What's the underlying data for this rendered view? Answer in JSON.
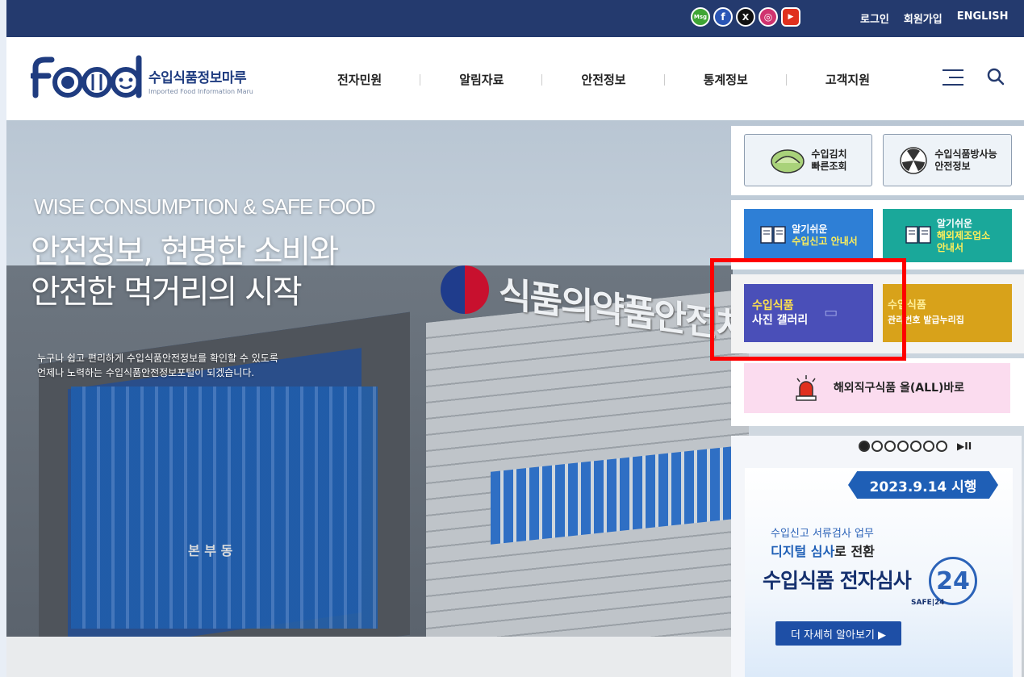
{
  "top_bar": {
    "social": [
      {
        "name": "kakaotalk-icon",
        "glyph": "Msg"
      },
      {
        "name": "facebook-icon",
        "glyph": "f"
      },
      {
        "name": "x-twitter-icon",
        "glyph": "X"
      },
      {
        "name": "instagram-icon",
        "glyph": "◎"
      },
      {
        "name": "youtube-icon",
        "glyph": "▶"
      }
    ],
    "login": "로그인",
    "signup": "회원가입",
    "english": "ENGLISH"
  },
  "header": {
    "logo_ko": "수입식품정보마루",
    "logo_en": "Imported Food Information Maru",
    "nav": [
      "전자민원",
      "알림자료",
      "안전정보",
      "통계정보",
      "고객지원"
    ]
  },
  "hero": {
    "en_title": "WISE CONSUMPTION & SAFE FOOD",
    "title_line1": "안전정보, 현명한 소비와",
    "title_line2": "안전한 먹거리의 시작",
    "sub_line1": "누구나 쉽고 편리하게 수입식품안전정보를 확인할 수 있도록",
    "sub_line2": "언제나 노력하는 수입식품안전정보포털이 되겠습니다.",
    "building_sign": "식품의약품안전처",
    "building_label": "본 부 동"
  },
  "quick": {
    "kimchi": {
      "line1": "수입김치",
      "line2": "빠른조회"
    },
    "radiation": {
      "line1": "수입식품방사능",
      "line2": "안전정보"
    },
    "guide_import": {
      "line1": "알기쉬운",
      "line2": "수입신고 안내서"
    },
    "guide_overseas": {
      "line1": "알기쉬운",
      "line2": "해외제조업소",
      "line3": "안내서"
    },
    "photo_gallery": {
      "line1": "수입식품",
      "line2": "사진 갤러리"
    },
    "mgmt_number": {
      "line1": "수입식품",
      "line2": "관리번호 발급누리집"
    },
    "direct_purchase": "해외직구식품 올(ALL)바로"
  },
  "banner": {
    "date": "2023.9.14 시행",
    "line1": "수입신고 서류검사 업무",
    "line2_bold": "디지털 심사",
    "line2_rest": "로 전환",
    "headline": "수입식품 전자심사",
    "badge": "24",
    "safe_label": "SAFE|24",
    "more": "더 자세히 알아보기 ▶",
    "controls": "▶II"
  },
  "colors": {
    "top_bar": "#243a6e",
    "brand_navy": "#1f3c80",
    "blue_card": "#2e7fd6",
    "teal_card": "#1aa89a",
    "indigo_card": "#4a4fb8",
    "gold_card": "#d8a21a",
    "pink_card": "#fbdcef",
    "highlight_red": "#ff0000"
  }
}
